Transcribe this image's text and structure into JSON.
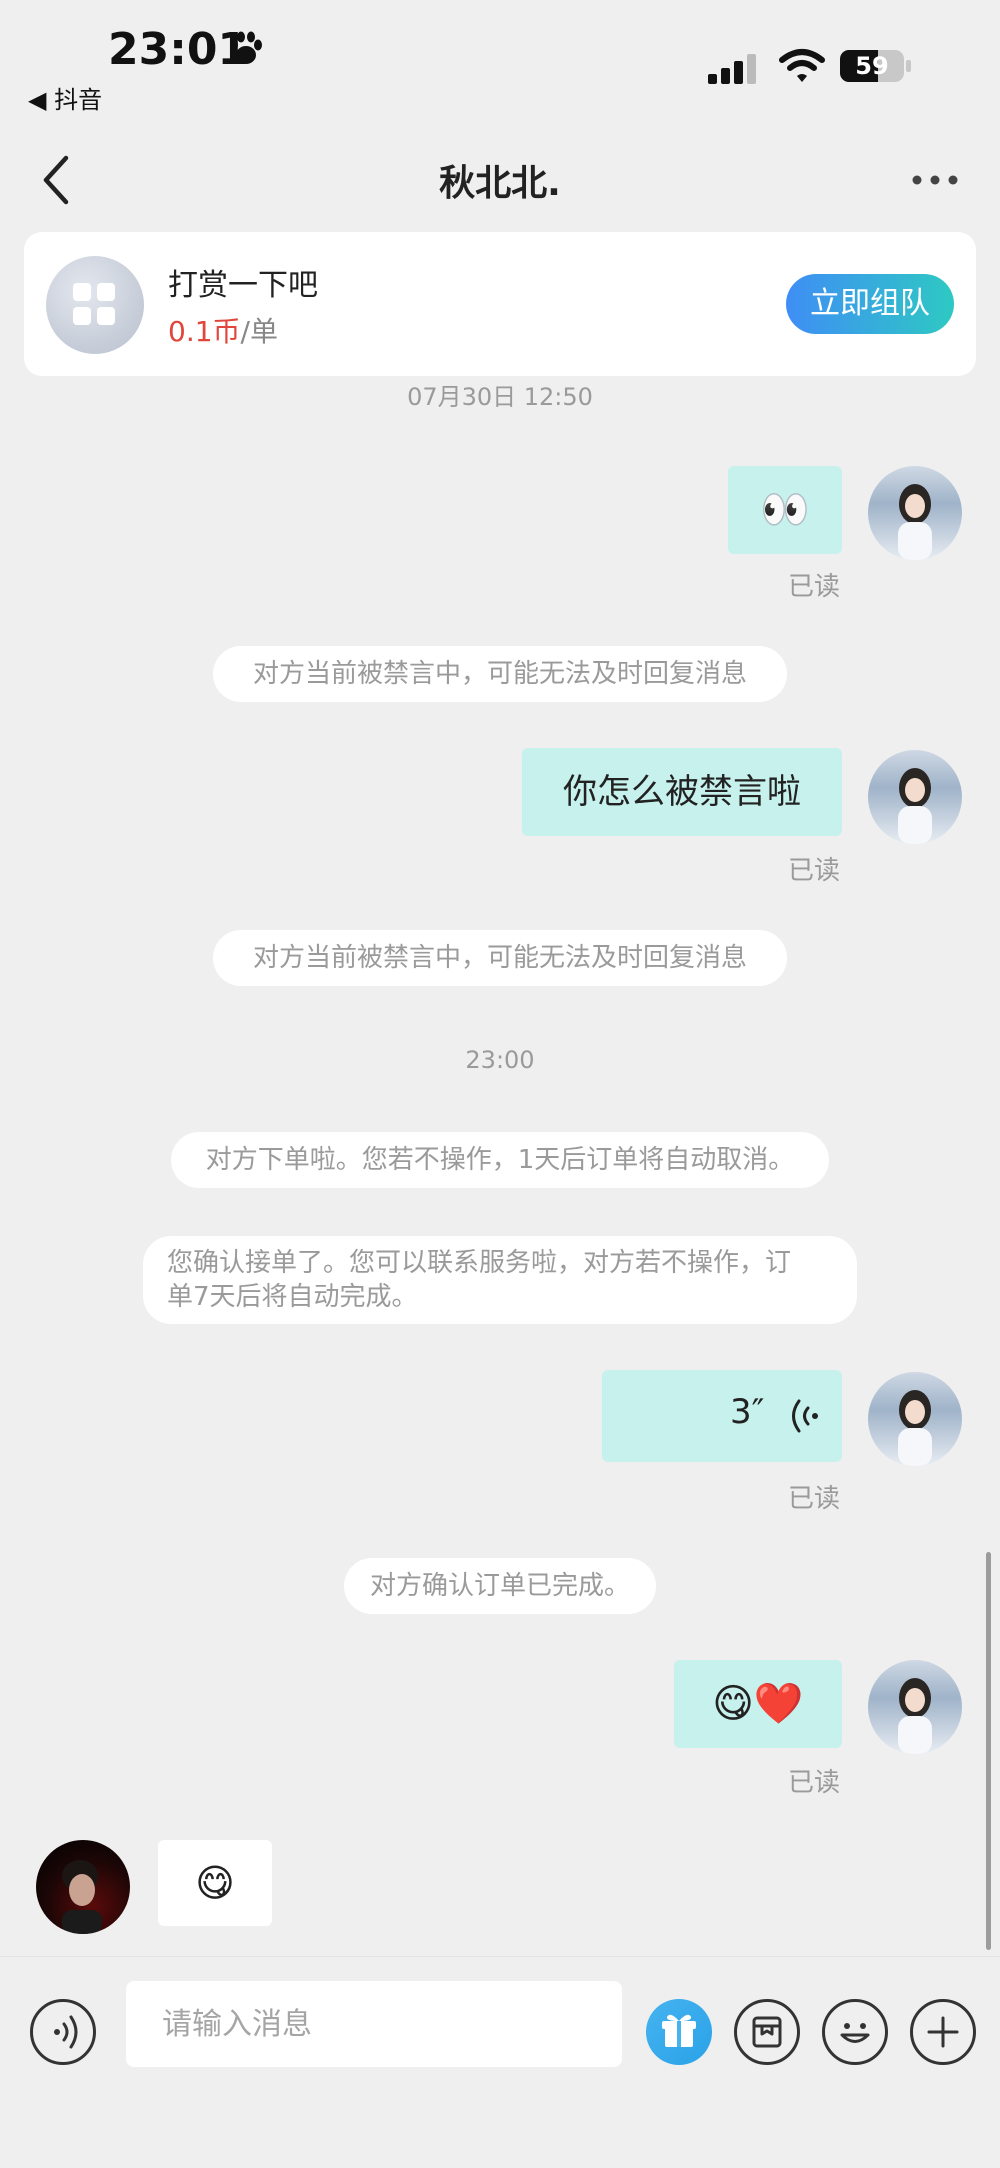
{
  "status_bar": {
    "time": "23:01",
    "back_app": "◀ 抖音",
    "battery": "59"
  },
  "nav": {
    "title": "秋北北."
  },
  "card": {
    "title": "打赏一下吧",
    "price": "0.1币",
    "unit": "/单",
    "button": "立即组队"
  },
  "messages": {
    "ts1": "07月30日 12:50",
    "m1_emoji": "👀",
    "read": "已读",
    "sys_muted": "对方当前被禁言中，可能无法及时回复消息",
    "m2_text": "你怎么被禁言啦",
    "ts2": "23:00",
    "sys_order": "对方下单啦。您若不操作，1天后订单将自动取消。",
    "sys_confirm_line1": "您确认接单了。您可以联系服务啦，对方若不操作，订",
    "sys_confirm_line2": "单7天后将自动完成。",
    "voice_duration": "3″",
    "sys_done": "对方确认订单已完成。",
    "m4_emoji": "😋❤️",
    "in_emoji": "😋"
  },
  "input": {
    "placeholder": "请输入消息"
  },
  "colors": {
    "bubble_out": "#c6f1ec",
    "accent_red": "#e0463c",
    "team_gradient_start": "#3f8ef5",
    "team_gradient_end": "#2ec9c3"
  }
}
